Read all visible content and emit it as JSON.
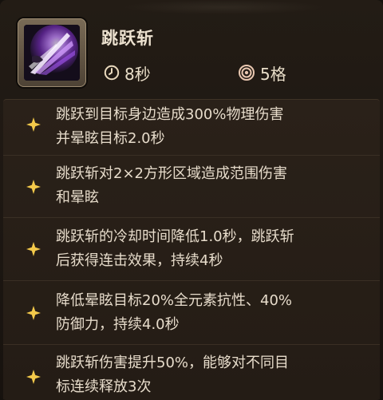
{
  "skill": {
    "icon": "purple-slash-skill-icon",
    "name": "跳跃斩",
    "cooldown": "8秒",
    "cooldown_icon": "clock-icon",
    "range": "5格",
    "range_icon": "target-icon"
  },
  "effects": [
    {
      "line1": "跳跃到目标身边造成300%物理伤害",
      "line2": "并晕眩目标2.0秒"
    },
    {
      "line1": "跳跃斩对2×2方形区域造成范围伤害",
      "line2": "和晕眩"
    },
    {
      "line1": "跳跃斩的冷却时间降低1.0秒，跳跃斩",
      "line2": "后获得连击效果，持续4秒"
    },
    {
      "line1": "降低晕眩目标20%全元素抗性、40%",
      "line2": "防御力，持续4.0秒"
    },
    {
      "line1": "跳跃斩伤害提升50%，能够对不同目",
      "line2": "标连续释放3次"
    }
  ],
  "colors": {
    "panel": "#241c15",
    "text": "#e7dccb",
    "star": "#f3c94a",
    "accent_purple": "#b06cff"
  }
}
